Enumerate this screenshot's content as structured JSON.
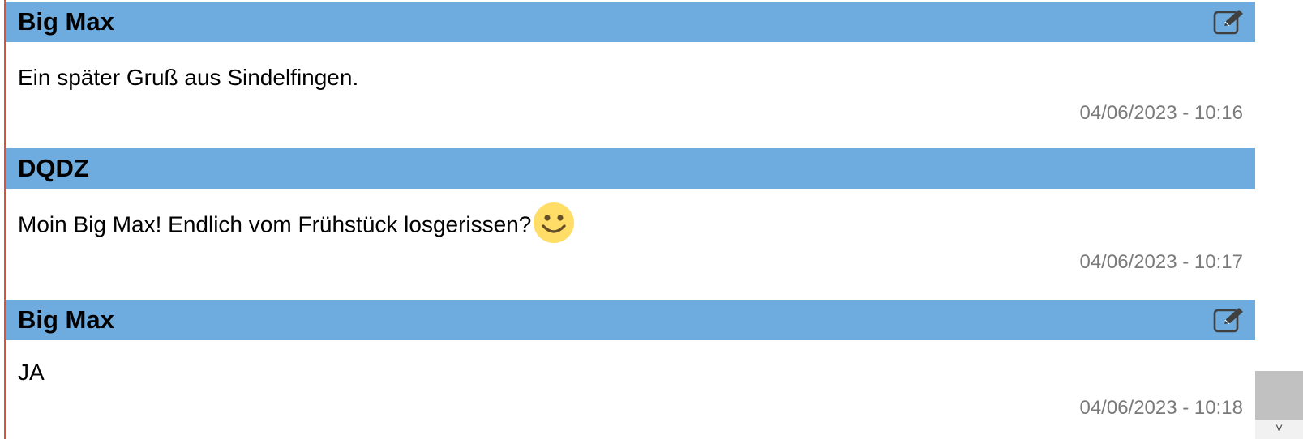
{
  "messages": [
    {
      "author": "Big Max",
      "text": "Ein später Gruß aus Sindelfingen.",
      "timestamp": "04/06/2023 - 10:16",
      "editable": true,
      "emoji": null
    },
    {
      "author": "DQDZ",
      "text": "Moin Big Max! Endlich vom Frühstück losgerissen?",
      "timestamp": "04/06/2023 - 10:17",
      "editable": false,
      "emoji": "smiley-face"
    },
    {
      "author": "Big Max",
      "text": "JA",
      "timestamp": "04/06/2023 - 10:18",
      "editable": true,
      "emoji": null
    }
  ],
  "icons": {
    "edit": "edit-icon",
    "emoji": "smiley-face-icon",
    "scroll_down": "chevron-down-icon"
  },
  "colors": {
    "header_bg": "#6eabdf",
    "left_border": "#d9523b",
    "timestamp": "#7a7a7a",
    "emoji_fill": "#ffdd67"
  },
  "scrollbar": {
    "down_arrow": "˅"
  }
}
